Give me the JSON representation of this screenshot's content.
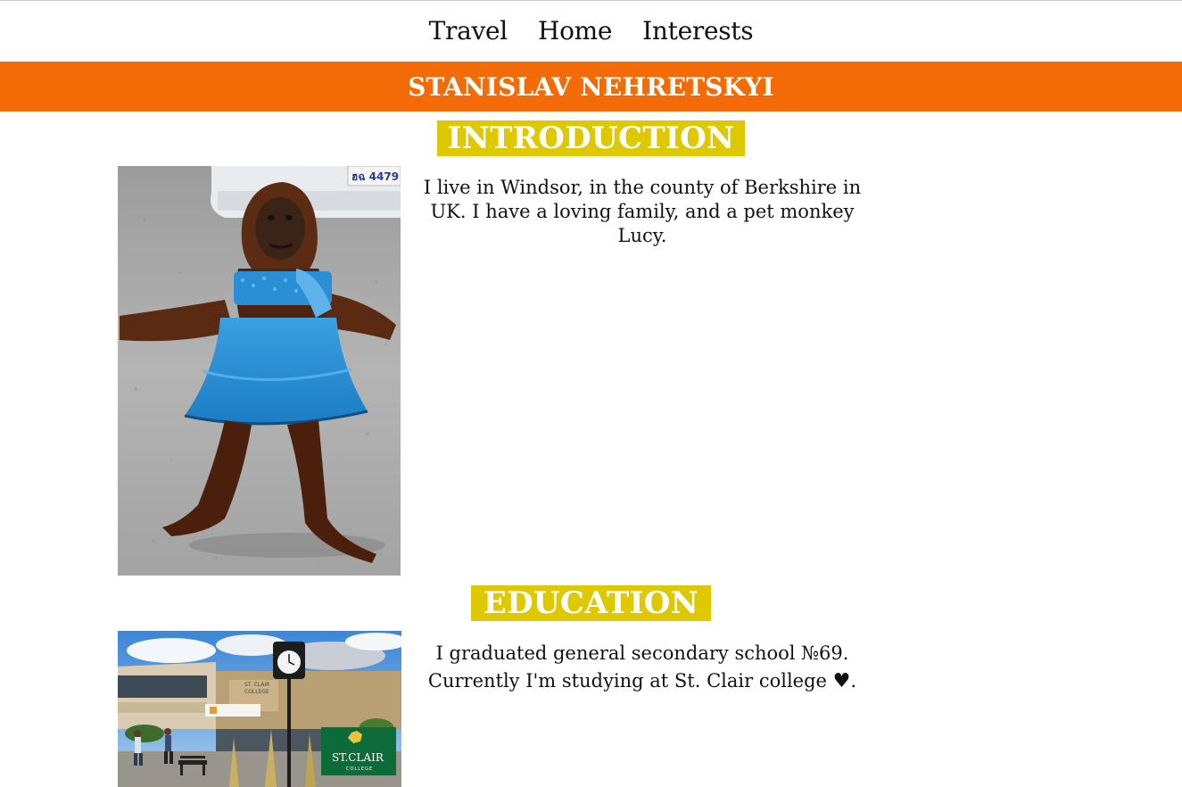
{
  "nav": {
    "items": [
      {
        "label": "Travel"
      },
      {
        "label": "Home"
      },
      {
        "label": "Interests"
      }
    ]
  },
  "header": {
    "name": "STANISLAV NEHRETSKYI"
  },
  "introduction": {
    "title": "INTRODUCTION",
    "text": "I live in Windsor, in the county of Berkshire in UK. I have a loving family, and a pet monkey Lucy.",
    "photo_plate": "ฮฉ 4479"
  },
  "education": {
    "title": "EDUCATION",
    "text_before": "I graduated general secondary school №69. Currently I'm studying at St. Clair college ",
    "heart": "♥",
    "text_after": ".",
    "photo_signs": {
      "building_sign_1": "ST. CLAIR",
      "building_sign_2": "COLLEGE",
      "logo_name": "ST.CLAIR",
      "logo_sub": "COLLEGE"
    }
  },
  "colors": {
    "banner": "#f36b06",
    "section_title_bg": "#dec800",
    "logo_green": "#0d6b3a"
  }
}
